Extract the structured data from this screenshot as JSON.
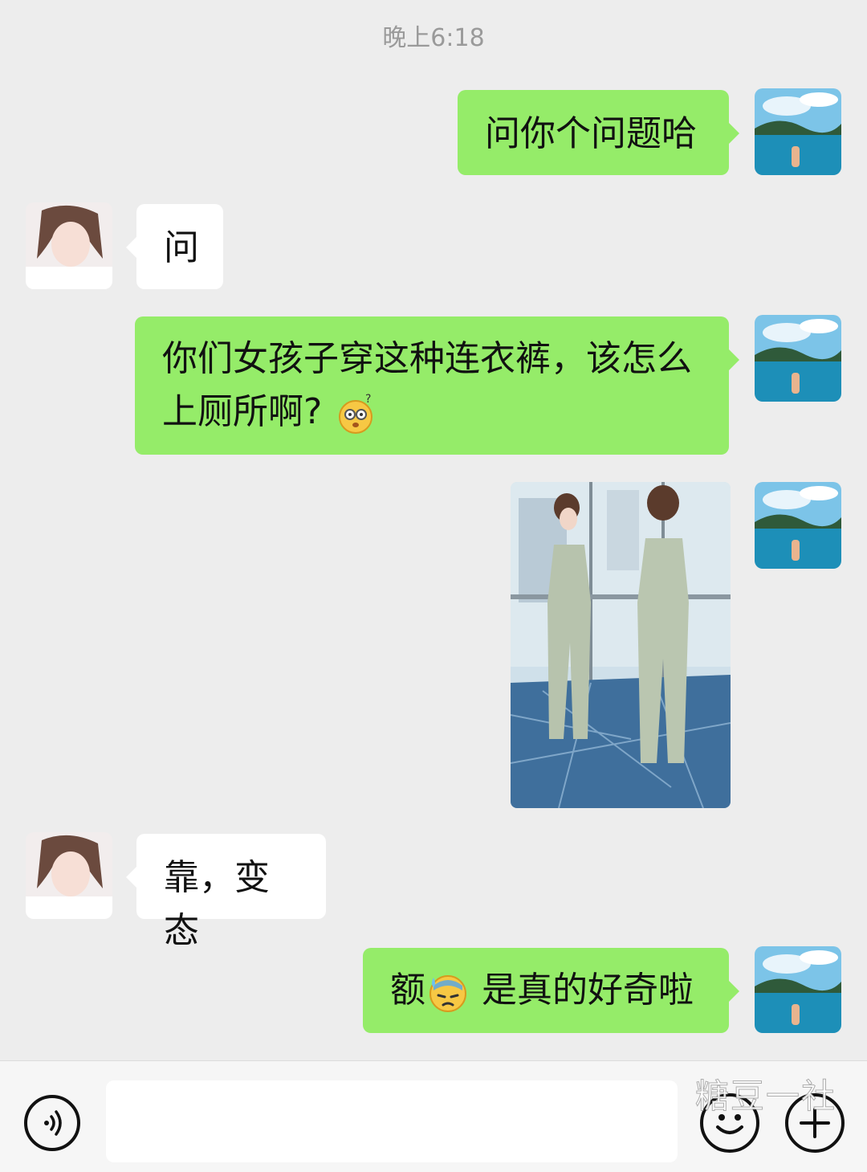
{
  "chat": {
    "timestamp": "晚上6:18",
    "messages": [
      {
        "from": "me",
        "text": "问你个问题哈"
      },
      {
        "from": "her",
        "text": "问"
      },
      {
        "from": "me",
        "line1": "你们女孩子穿这种连衣裤，该怎么",
        "line2": "上厕所啊?",
        "emoji": "dizzy-face-icon"
      },
      {
        "from": "me",
        "type": "image",
        "image_desc": "jumpsuit-photo"
      },
      {
        "from": "her",
        "text": "靠，变态"
      },
      {
        "from": "me",
        "text_before": "额",
        "emoji": "sweat-face-icon",
        "text_after": " 是真的好奇啦"
      }
    ]
  },
  "input_bar": {
    "voice_icon": "voice-icon",
    "emoji_icon": "emoji-icon",
    "plus_icon": "plus-icon",
    "placeholder": ""
  },
  "watermark": "糖豆一社",
  "colors": {
    "background": "#ededed",
    "outgoing_bubble": "#95ec69",
    "incoming_bubble": "#ffffff",
    "timestamp": "#9a9a9a"
  }
}
